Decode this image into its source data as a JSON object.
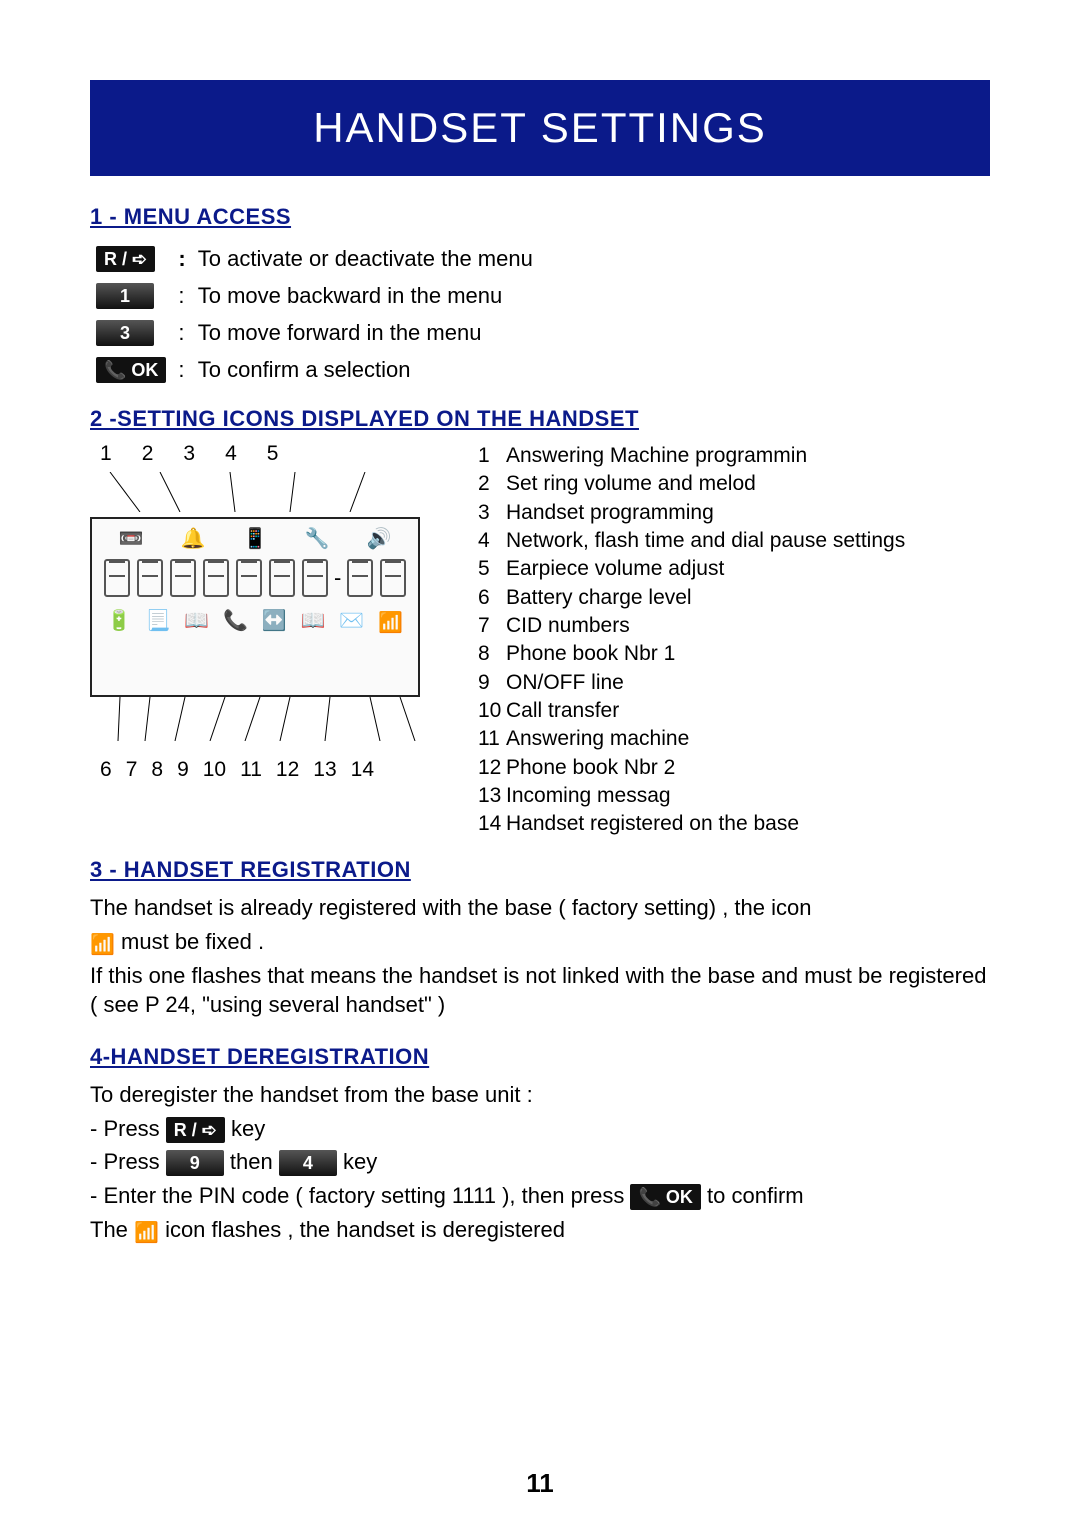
{
  "title": "HANDSET SETTINGS",
  "page_number": "11",
  "sections": {
    "menu_access": {
      "heading": "1 -  MENU ACCESS",
      "rows": [
        {
          "key": "R / ➪",
          "desc": "To activate or deactivate the menu"
        },
        {
          "key": "1",
          "desc": "To move backward in the menu"
        },
        {
          "key": "3",
          "desc": "To move forward in the menu"
        },
        {
          "key": "📞 OK",
          "desc": "To confirm a selection"
        }
      ]
    },
    "setting_icons": {
      "heading": "2 -SETTING ICONS DISPLAYED ON THE HANDSET",
      "top_labels": [
        "1",
        "2",
        "3",
        "4",
        "5"
      ],
      "bottom_labels": [
        "6",
        "7",
        "8",
        "9",
        "10",
        "11",
        "12",
        "13",
        "14"
      ],
      "legend": [
        "Answering Machine programmin",
        "Set ring volume and melod",
        "Handset programming",
        "Network, flash time and dial pause settings",
        "Earpiece volume adjust",
        "Battery charge level",
        "CID numbers",
        "Phone book Nbr 1",
        "ON/OFF line",
        "Call transfer",
        "Answering machine",
        "Phone book Nbr 2",
        "Incoming messag",
        "Handset registered on the base"
      ]
    },
    "registration": {
      "heading": "3 - HANDSET REGISTRATION",
      "line1": "The handset is already registered with the base ( factory setting) , the icon",
      "line2_after_icon": "must be  fixed .",
      "line3": "If this one flashes that means the handset is not linked with the base and must be registered ( see P 24, \"using several handset\" )"
    },
    "deregistration": {
      "heading": "4-HANDSET DEREGISTRATION",
      "intro": "To deregister the handset  from the base unit :",
      "step1_pre": "- Press ",
      "step1_key": "R / ➪",
      "step1_post": " key",
      "step2_pre": "- Press ",
      "step2_key1": "9",
      "step2_mid": " then ",
      "step2_key2": "4",
      "step2_post": " key",
      "step3_pre": "- Enter the PIN code ( factory setting 1111 ), then press ",
      "step3_key": "📞 OK",
      "step3_post": " to confirm",
      "final_pre": "The ",
      "final_post": " icon flashes , the handset is deregistered"
    }
  }
}
